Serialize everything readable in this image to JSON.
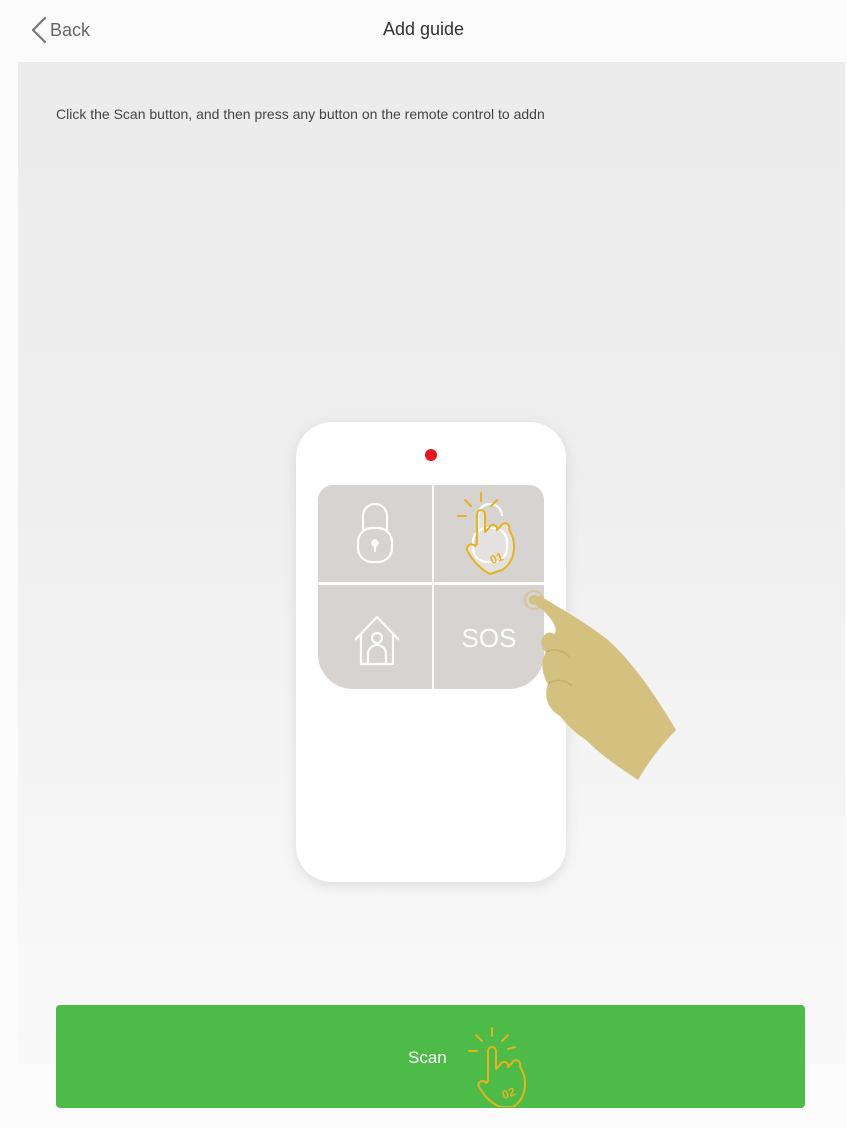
{
  "header": {
    "back_label": "Back",
    "title": "Add guide"
  },
  "main": {
    "instruction": "Click the Scan button, and then press any button on the remote control to addn",
    "remote": {
      "sos_label": "SOS",
      "step1_label": "01"
    }
  },
  "footer": {
    "scan_label": "Scan",
    "step2_label": "02"
  },
  "colors": {
    "accent_green": "#4cbb47",
    "hand_gold": "#d4c17f",
    "hint_gold": "#e8b21c",
    "indicator_red": "#e8141c"
  },
  "icons": [
    "chevron-left-icon",
    "lock-icon",
    "home-icon",
    "tap-hand-icon",
    "pointing-hand-icon"
  ]
}
